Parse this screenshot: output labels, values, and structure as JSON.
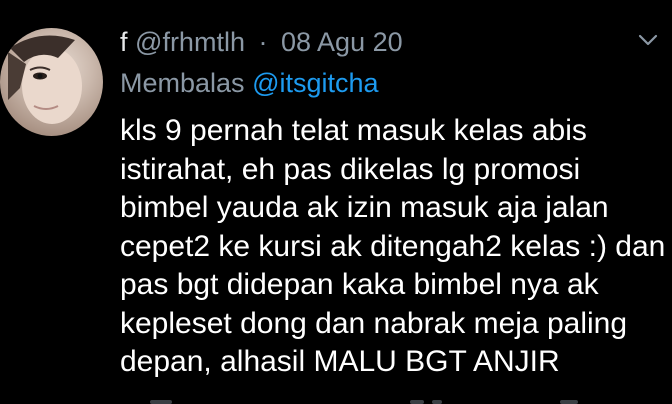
{
  "tweet": {
    "author_name": "f",
    "handle": "@frhmtlh",
    "separator": "·",
    "date": "08 Agu 20",
    "reply_prefix": "Membalas",
    "reply_to": "@itsgitcha",
    "text_lines": [
      "kls 9 pernah telat masuk kelas abis",
      "istirahat, eh pas dikelas lg promosi",
      "bimbel yauda ak izin masuk aja jalan",
      "cepet2 ke kursi ak ditengah2 kelas :) dan",
      "pas bgt didepan kaka bimbel nya ak",
      "kepleset dong dan nabrak meja paling",
      "depan, alhasil MALU BGT ANJIR"
    ]
  },
  "icons": {
    "menu": "chevron-down-icon",
    "avatar": "avatar"
  },
  "colors": {
    "background": "#000000",
    "text": "#ffffff",
    "secondary_text": "#8b98a5",
    "mention": "#1d9bf0"
  }
}
